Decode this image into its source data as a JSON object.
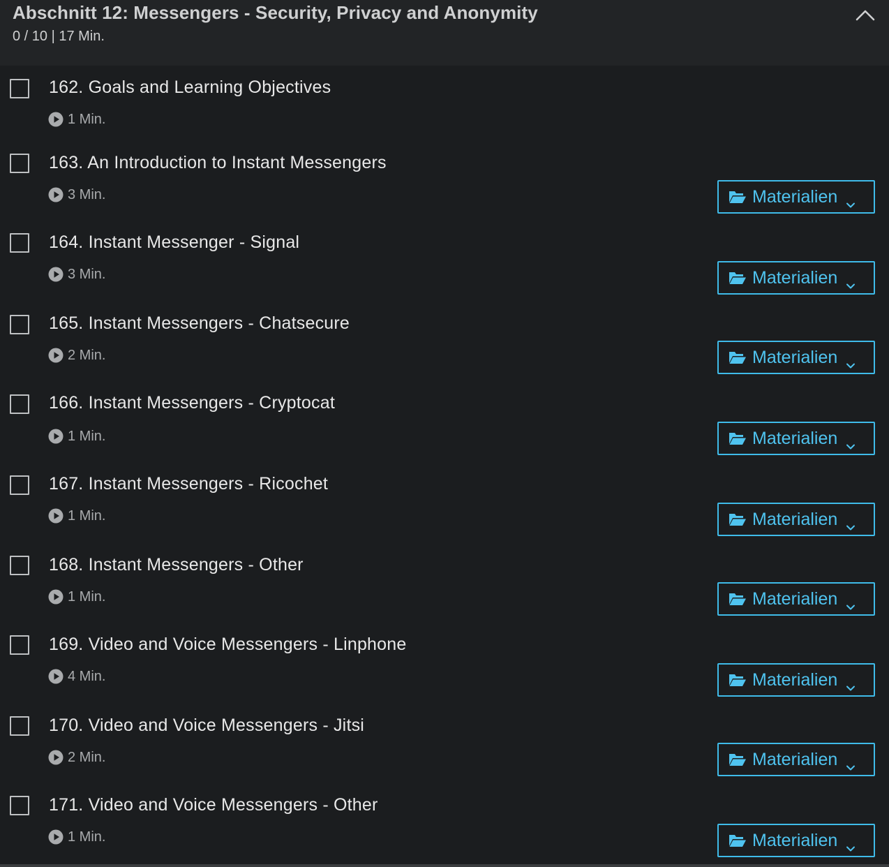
{
  "section": {
    "title": "Abschnitt 12: Messengers - Security, Privacy and Anonymity",
    "meta": "0 / 10 | 17 Min.",
    "collapse_icon": "chevron-up-icon"
  },
  "colors": {
    "accent": "#3fbbe9",
    "background": "#1b1d1f",
    "header_background": "#222426"
  },
  "lectures": [
    {
      "title": "162. Goals and Learning Objectives",
      "duration": "1 Min.",
      "completed": false,
      "resources_label": null
    },
    {
      "title": "163. An Introduction to Instant Messengers",
      "duration": "3 Min.",
      "completed": false,
      "resources_label": "Materialien"
    },
    {
      "title": "164. Instant Messenger - Signal",
      "duration": "3 Min.",
      "completed": false,
      "resources_label": "Materialien"
    },
    {
      "title": "165. Instant Messengers - Chatsecure",
      "duration": "2 Min.",
      "completed": false,
      "resources_label": "Materialien"
    },
    {
      "title": "166. Instant Messengers - Cryptocat",
      "duration": "1 Min.",
      "completed": false,
      "resources_label": "Materialien"
    },
    {
      "title": "167. Instant Messengers - Ricochet",
      "duration": "1 Min.",
      "completed": false,
      "resources_label": "Materialien"
    },
    {
      "title": "168. Instant Messengers - Other",
      "duration": "1 Min.",
      "completed": false,
      "resources_label": "Materialien"
    },
    {
      "title": "169. Video and Voice Messengers - Linphone",
      "duration": "4 Min.",
      "completed": false,
      "resources_label": "Materialien"
    },
    {
      "title": "170. Video and Voice Messengers - Jitsi",
      "duration": "2 Min.",
      "completed": false,
      "resources_label": "Materialien"
    },
    {
      "title": "171. Video and Voice Messengers - Other",
      "duration": "1 Min.",
      "completed": false,
      "resources_label": "Materialien"
    }
  ]
}
